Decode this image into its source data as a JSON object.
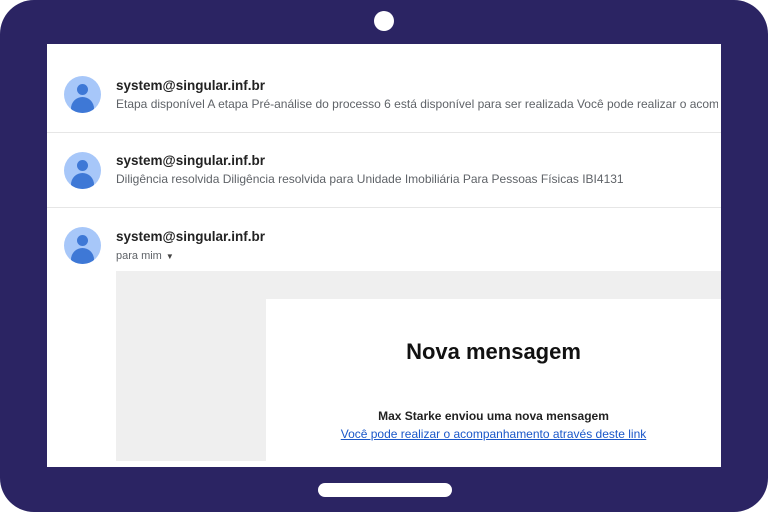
{
  "messages": [
    {
      "sender": "system@singular.inf.br",
      "snippet": "Etapa disponível A etapa Pré-análise do processo 6 está disponível para ser realizada Você pode realizar o acompanhamento"
    },
    {
      "sender": "system@singular.inf.br",
      "snippet": "Diligência resolvida Diligência resolvida para Unidade Imobiliária Para Pessoas Físicas IBI4131"
    },
    {
      "sender": "system@singular.inf.br",
      "recipient": "para mim"
    }
  ],
  "open_email": {
    "title": "Nova mensagem",
    "message": "Max Starke enviou uma nova mensagem",
    "link_text": "Você pode realizar o acompanhamento através deste link"
  },
  "colors": {
    "device_frame": "#2b2463",
    "avatar_bg": "#a7c7f9",
    "avatar_fg": "#3e78d6",
    "link": "#1a57c9"
  },
  "icons": {
    "avatar": "default-user-avatar-icon",
    "expand": "caret-down-icon"
  }
}
